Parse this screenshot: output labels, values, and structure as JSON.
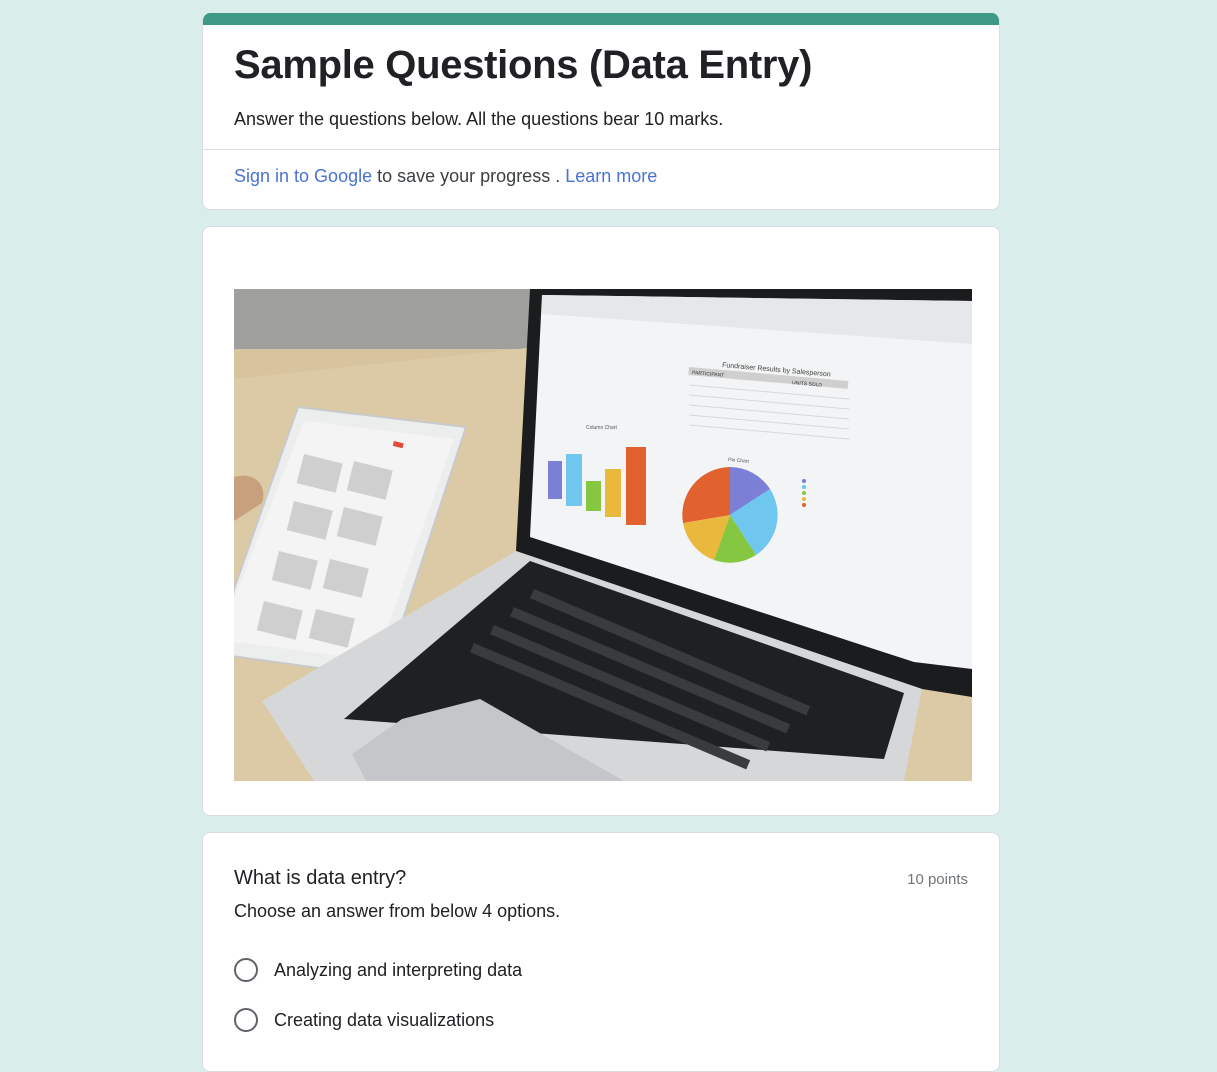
{
  "form": {
    "title": "Sample Questions (Data Entry)",
    "description": "Answer the questions below. All the questions bear 10 marks.",
    "accent_color": "#3d9985",
    "background_color": "#d9eeeb"
  },
  "signin": {
    "link_label": "Sign in to Google",
    "middle_text": "to save your progress .",
    "learn_more_label": "Learn more",
    "link_color": "#4a72d6"
  },
  "image": {
    "description": "laptop-and-tablet-with-charts-photo",
    "chart_title": "Fundraiser Results by Salesperson",
    "column_chart_label": "Column Chart",
    "pie_chart_label": "Pie Chart",
    "table_header_left": "PARTICIPANT",
    "table_header_right": "UNITS SOLD"
  },
  "question": {
    "title": "What is data entry?",
    "points": "10 points",
    "help_text": "Choose an answer from below 4 options.",
    "options": [
      {
        "label": "Analyzing and interpreting data"
      },
      {
        "label": "Creating data visualizations"
      }
    ]
  }
}
